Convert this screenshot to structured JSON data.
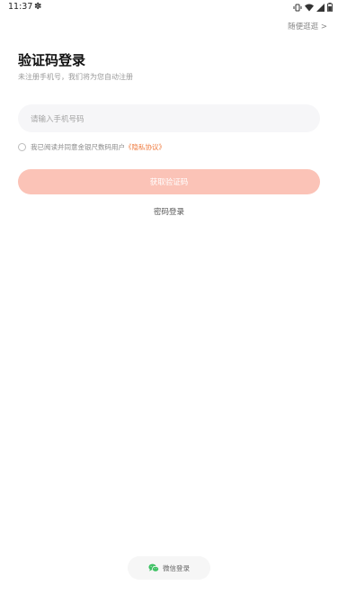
{
  "status_bar": {
    "time": "11:37",
    "app_icon": "✽"
  },
  "header": {
    "skip_label": "随便逛逛 >"
  },
  "main": {
    "title": "验证码登录",
    "subtitle": "未注册手机号，我们将为您自动注册",
    "phone_input": {
      "placeholder": "请输入手机号码",
      "value": ""
    },
    "agreement": {
      "text": "我已阅读并同意金银尺数码用户",
      "link": "《隐私协议》"
    },
    "code_button_label": "获取验证码",
    "password_login_label": "密码登录"
  },
  "footer": {
    "wechat_login_label": "微信登录"
  },
  "colors": {
    "accent": "#fbc3b7",
    "link": "#ef7a3e",
    "wechat": "#3cc162"
  }
}
